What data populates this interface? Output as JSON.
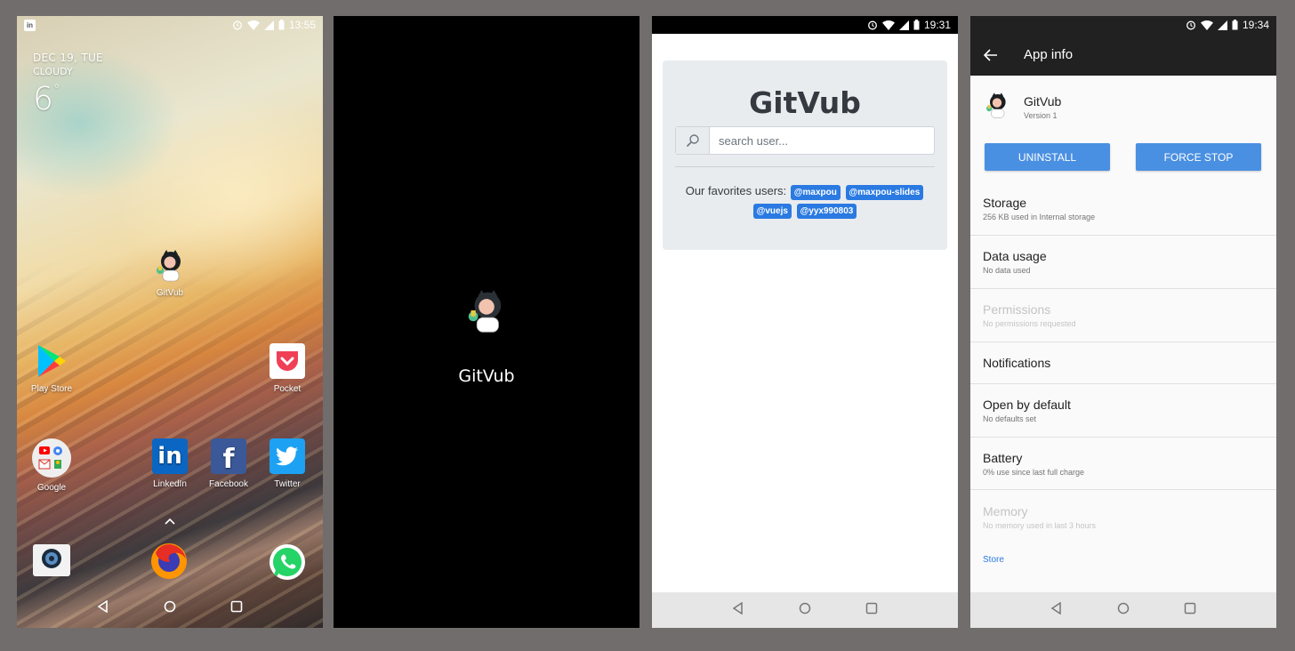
{
  "home": {
    "status_time": "13:55",
    "date": "DEC 19, TUE",
    "weather": "CLOUDY",
    "temperature": "6",
    "degree": "°",
    "apps": {
      "gitvub": "GitVub",
      "play_store": "Play Store",
      "pocket": "Pocket",
      "google": "Google",
      "linkedin": "LinkedIn",
      "facebook": "Facebook",
      "twitter": "Twitter"
    }
  },
  "splash": {
    "title": "GitVub"
  },
  "app": {
    "status_time": "19:31",
    "title": "GitVub",
    "search_placeholder": "search user...",
    "favorites_label": "Our favorites users:",
    "favorites": [
      "@maxpou",
      "@maxpou-slides",
      "@vuejs",
      "@yyx990803"
    ]
  },
  "appinfo": {
    "status_time": "19:34",
    "title": "App info",
    "app_name": "GitVub",
    "version": "Version 1",
    "uninstall": "UNINSTALL",
    "force_stop": "FORCE STOP",
    "rows": [
      {
        "title": "Storage",
        "subtitle": "256 KB used in Internal storage"
      },
      {
        "title": "Data usage",
        "subtitle": "No data used"
      },
      {
        "title": "Permissions",
        "subtitle": "No permissions requested"
      },
      {
        "title": "Notifications",
        "subtitle": ""
      },
      {
        "title": "Open by default",
        "subtitle": "No defaults set"
      },
      {
        "title": "Battery",
        "subtitle": "0% use since last full charge"
      },
      {
        "title": "Memory",
        "subtitle": "No memory used in last 3 hours"
      }
    ],
    "store_link": "Store"
  },
  "colors": {
    "accent": "#4a90e2",
    "tag": "#2a7ae2",
    "appbar": "#212121"
  }
}
